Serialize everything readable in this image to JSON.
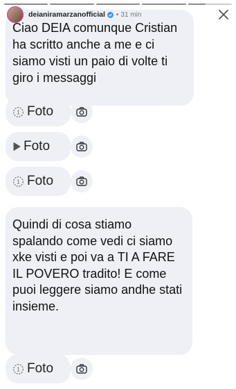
{
  "story": {
    "username": "deianiramarzanofficial",
    "time": "31 min",
    "separator": "•",
    "segments": [
      1,
      1,
      1,
      1,
      0.4
    ],
    "close_icon": "close-icon",
    "verified_icon": "verified-badge-icon"
  },
  "chat": {
    "message1": "Ciao DEIA comunque Cristian ha scritto anche a me e ci siamo visti un paio di volte ti giro i messaggi",
    "message2": "Quindi di cosa stiamo spalando come vedi ci siamo xke visti e poi va a TI A FARE IL POVERO tradito! E come puoi leggere siamo andhe stati insieme.",
    "attachments": [
      {
        "label": "Foto",
        "icon": "view-once-icon"
      },
      {
        "label": "Foto",
        "icon": "play-icon"
      },
      {
        "label": "Foto",
        "icon": "view-once-icon"
      },
      {
        "label": "Foto",
        "icon": "view-once-icon"
      }
    ],
    "camera_icon": "camera-icon"
  }
}
